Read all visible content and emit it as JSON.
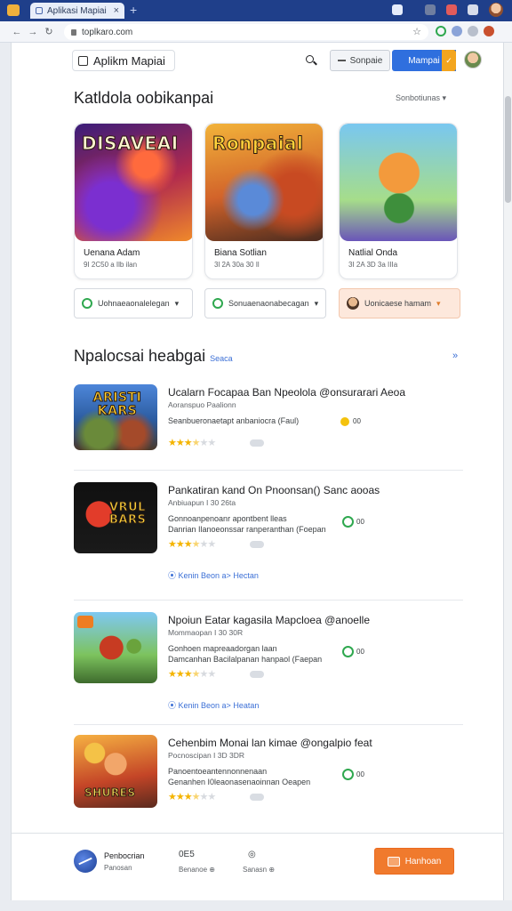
{
  "browser": {
    "tab_title": "Aplikasi Mapiai",
    "url": "toplkaro.com",
    "new_tab": "+",
    "close": "×"
  },
  "header": {
    "title": "Aplikm Mapiai",
    "secondary_button": "Sonpaie",
    "primary_button": "Mampai"
  },
  "featured": {
    "title": "Katldola oobikanpai",
    "sort_label": "Sonbotiunas ▾",
    "cards": [
      {
        "art_text": "DISAVEAI",
        "name": "Uenana Adam",
        "meta": "9I 2C50 a Ilb ilan"
      },
      {
        "art_text": "Ronpaial",
        "name": "Biana Sotlian",
        "meta": "3l 2A 30a 30 Il"
      },
      {
        "art_text": "",
        "name": "Natlial Onda",
        "meta": "3I 2A 3D 3a IIIa"
      }
    ],
    "filters": [
      {
        "label": "Uohnaeaonalelegan"
      },
      {
        "label": "Sonuaenaonabecagan"
      },
      {
        "label": "Uonicaese hamam"
      }
    ]
  },
  "popular": {
    "title": "Npalocsai heabgai",
    "subtitle": "Seaca",
    "more": "»",
    "items": [
      {
        "icon_text": "ARISTI KARS",
        "title": "Ucalarn Focapaa Ban Npeolola @onsurarari Aeoa",
        "sub": "Aoranspuo Paalionn",
        "desc": "Seanbueronaetapt anbaniocra (Faul)",
        "desc2": "",
        "badge": "00",
        "stars": 3,
        "links": ""
      },
      {
        "icon_text": "VRUL BARS",
        "title": "Pankatiran kand On Pnoonsan() Sanc aooas",
        "sub": "Anbiuapun I 30 26ta",
        "desc": "Gonnoanpenoanr apontbent lleas",
        "desc2": "Danrian Ilanoeonssar ranperanthan (Foepan",
        "badge": "00",
        "stars": 3,
        "links": "Kenin Beon a>  Hectan"
      },
      {
        "icon_text": "",
        "title": "Npoiun Eatar kagasila Mapcloea @anoelle",
        "sub": "Mommaopan I 30 30R",
        "desc": "Gonhoen mapreaadorgan laan",
        "desc2": "Damcanhan Bacilalpanan hanpaol (Faepan",
        "badge": "00",
        "stars": 3,
        "links": "Kenin Beon a>  Heatan"
      },
      {
        "icon_text": "SHURES",
        "title": "Cehenbim Monai lan kimae @ongalpio feat",
        "sub": "Pocnoscipan I 3D 3DR",
        "desc": "Panoentoeantennonnenaan",
        "desc2": "Genanhen I0leaonasenaoinnan Oeapen",
        "badge": "00",
        "stars": 3,
        "links": ""
      }
    ]
  },
  "footer": {
    "name": "Penbocrian",
    "sub": "Panosan",
    "col1_top": "0E5",
    "col1_bottom": "Benanoe  ⊕",
    "col2_top": "◎",
    "col2_bottom": "Sanasn  ⊕",
    "cta": "Hanhoan"
  },
  "colors": {
    "tabstrip": "#1f3f8a",
    "primary": "#2f6fde",
    "accent_orange": "#f07a2d",
    "star": "#f4b400",
    "link_blue": "#3b6fd6"
  }
}
